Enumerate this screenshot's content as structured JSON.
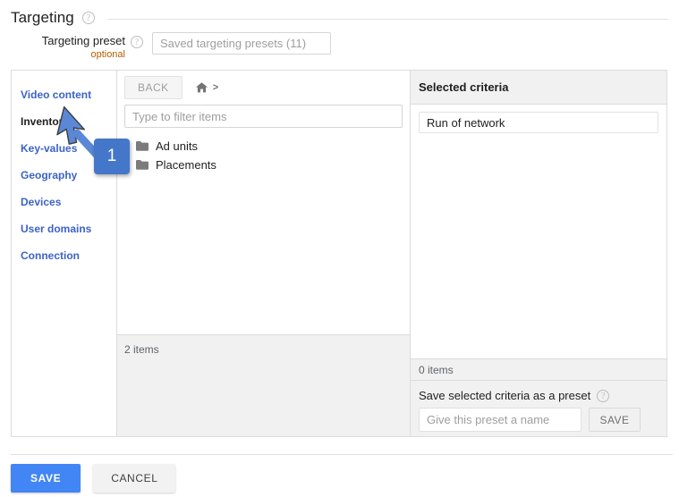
{
  "section": {
    "title": "Targeting",
    "help_icon": "help-circle-icon"
  },
  "preset": {
    "label": "Targeting preset",
    "optional_note": "optional",
    "help_icon": "help-circle-icon",
    "placeholder": "Saved targeting presets (11)",
    "value": ""
  },
  "categories": [
    {
      "label": "Video content",
      "selected": false
    },
    {
      "label": "Inventory",
      "selected": true
    },
    {
      "label": "Key-values",
      "selected": false
    },
    {
      "label": "Geography",
      "selected": false
    },
    {
      "label": "Devices",
      "selected": false
    },
    {
      "label": "User domains",
      "selected": false
    },
    {
      "label": "Connection",
      "selected": false
    }
  ],
  "browser": {
    "back_label": "BACK",
    "home_icon": "home-icon",
    "breadcrumb_separator": ">",
    "filter_placeholder": "Type to filter items",
    "filter_value": "",
    "items": [
      {
        "label": "Ad units",
        "icon": "folder-icon"
      },
      {
        "label": "Placements",
        "icon": "folder-icon"
      }
    ],
    "item_count_label": "2 items"
  },
  "selected_criteria": {
    "header": "Selected criteria",
    "chips": [
      {
        "label": "Run of network"
      }
    ],
    "count_label": "0 items"
  },
  "save_preset": {
    "title": "Save selected criteria as a preset",
    "help_icon": "help-circle-icon",
    "name_placeholder": "Give this preset a name",
    "name_value": "",
    "save_label": "SAVE"
  },
  "footer": {
    "save_label": "SAVE",
    "cancel_label": "CANCEL"
  },
  "annotation": {
    "badge_number": "1",
    "arrow_icon": "cursor-arrow-icon",
    "color": "#4477c9"
  },
  "colors": {
    "accent": "#4285f4",
    "link": "#3b63c7",
    "optional": "#b06000",
    "panel_bg": "#f1f1f1",
    "border": "#dcdcdc"
  }
}
